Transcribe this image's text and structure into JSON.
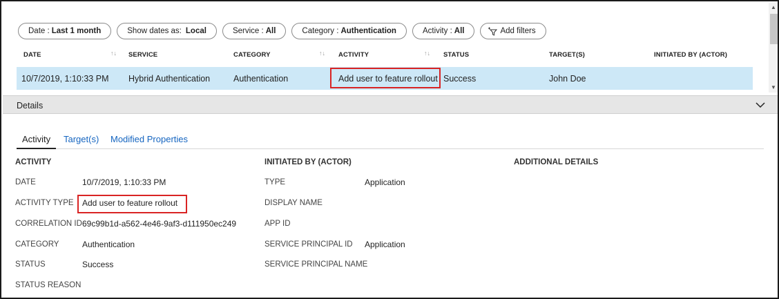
{
  "filters": {
    "date": {
      "label": "Date :",
      "value": "Last 1 month"
    },
    "show_dates": {
      "label": "Show dates as:",
      "value": "Local"
    },
    "service": {
      "label": "Service :",
      "value": "All"
    },
    "category": {
      "label": "Category :",
      "value": "Authentication"
    },
    "activity": {
      "label": "Activity :",
      "value": "All"
    },
    "add_filters": "Add filters"
  },
  "table": {
    "columns": [
      "DATE",
      "SERVICE",
      "CATEGORY",
      "ACTIVITY",
      "STATUS",
      "TARGET(S)",
      "INITIATED BY (ACTOR)"
    ],
    "rows": [
      {
        "date": "10/7/2019, 1:10:33 PM",
        "service": "Hybrid Authentication",
        "category": "Authentication",
        "activity": "Add user to feature rollout",
        "status": "Success",
        "targets": "John Doe",
        "initiated_by": ""
      }
    ]
  },
  "details": {
    "bar_label": "Details",
    "tabs": [
      "Activity",
      "Target(s)",
      "Modified Properties"
    ],
    "activity_section": {
      "heading": "ACTIVITY",
      "fields": [
        {
          "label": "DATE",
          "value": "10/7/2019, 1:10:33 PM"
        },
        {
          "label": "ACTIVITY TYPE",
          "value": "Add user to feature rollout"
        },
        {
          "label": "CORRELATION ID",
          "value": "69c99b1d-a562-4e46-9af3-d111950ec249"
        },
        {
          "label": "CATEGORY",
          "value": "Authentication"
        },
        {
          "label": "STATUS",
          "value": "Success"
        },
        {
          "label": "STATUS REASON",
          "value": ""
        }
      ]
    },
    "initiated_section": {
      "heading": "INITIATED BY (ACTOR)",
      "fields": [
        {
          "label": "TYPE",
          "value": "Application"
        },
        {
          "label": "DISPLAY NAME",
          "value": ""
        },
        {
          "label": "APP ID",
          "value": ""
        },
        {
          "label": "SERVICE PRINCIPAL ID",
          "value": "Application"
        },
        {
          "label": "SERVICE PRINCIPAL NAME",
          "value": ""
        }
      ]
    },
    "additional_section": {
      "heading": "ADDITIONAL DETAILS"
    }
  },
  "colors": {
    "selected_row": "#cde8f7",
    "highlight": "#d92323",
    "link": "#1565c0"
  },
  "icons": [
    "sort-arrows-icon",
    "filter-add-icon",
    "chevron-down-icon",
    "scroll-up-icon",
    "scroll-down-icon"
  ]
}
